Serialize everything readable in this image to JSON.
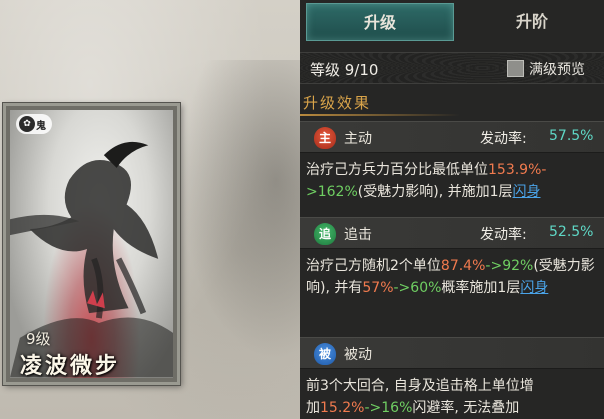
{
  "tabs": {
    "upgrade": "升级",
    "advance": "升阶"
  },
  "level": {
    "text": "等级 9/10",
    "preview_label": "满级预览"
  },
  "section_title": "升级效果",
  "card": {
    "badge_text": "鬼",
    "level": "9级",
    "name": "凌波微步"
  },
  "skills": [
    {
      "icon_char": "主",
      "type": "主动",
      "trigger_label": "发动率:",
      "trigger_value": "57.5%",
      "desc": {
        "p1": "治疗己方兵力百分比最低单位",
        "old": "153.9%",
        "sep": "-",
        "arrow": ">162%",
        "p2": "(受魅力影响), 并施加1层",
        "link": "闪身"
      }
    },
    {
      "icon_char": "追",
      "type": "追击",
      "trigger_label": "发动率:",
      "trigger_value": "52.5%",
      "desc": {
        "p1": "治疗己方随机2个单位",
        "old": "87.4%",
        "new": "->92%",
        "p2": "(受魅力影响), 并有",
        "old2": "57%",
        "new2": "->60%",
        "p3": "概率施加1层",
        "link": "闪身"
      }
    },
    {
      "icon_char": "被",
      "type": "被动",
      "desc": {
        "p1": "前3个大回合, 自身及追击格上单位增",
        "p2": "加",
        "old": "15.2%",
        "new": "->16%",
        "p3": "闪避率, 无法叠加"
      }
    }
  ],
  "colors": {
    "accent_gold": "#d9a44a",
    "value_teal": "#5fd8c6",
    "old_value": "#f07a4e",
    "new_value": "#6fce62",
    "link_blue": "#4aa3e8"
  }
}
